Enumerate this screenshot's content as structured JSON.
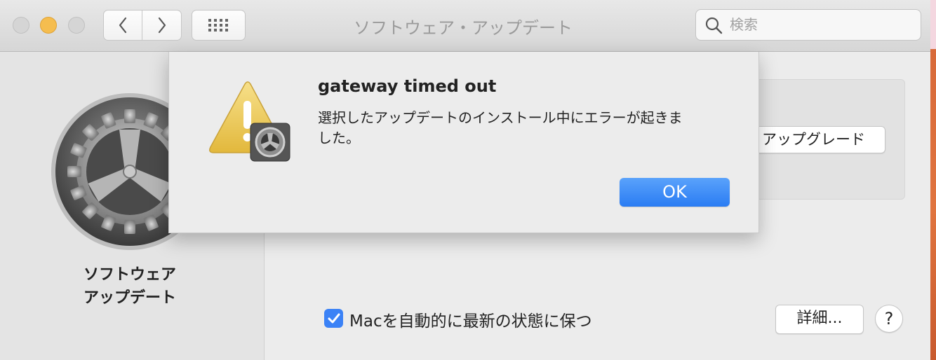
{
  "window": {
    "title": "ソフトウェア・アップデート"
  },
  "toolbar": {
    "back_icon": "chevron-left-icon",
    "forward_icon": "chevron-right-icon",
    "grid_icon": "grid-icon"
  },
  "search": {
    "placeholder": "検索",
    "icon": "search-icon"
  },
  "sidebar": {
    "icon": "gear-icon",
    "label_line1": "ソフトウェア",
    "label_line2": "アップデート"
  },
  "panel": {
    "upgrade_button": "アップグレード",
    "auto_update_checked": true,
    "auto_update_label": "Macを自動的に最新の状態に保つ",
    "details_button": "詳細...",
    "help_button": "?"
  },
  "alert": {
    "icon": "warning-icon",
    "title": "gateway timed out",
    "message": "選択したアップデートのインストール中にエラーが起きました。",
    "ok_button": "OK"
  }
}
